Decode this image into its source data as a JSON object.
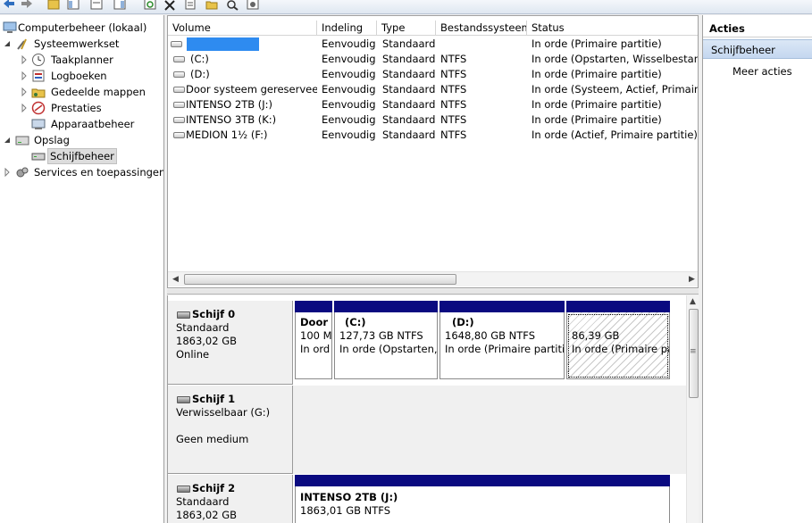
{
  "tree": {
    "items": [
      {
        "label": "Computerbeheer (lokaal)",
        "icon": "computer-icon"
      },
      {
        "label": "Systeemwerkset",
        "icon": "tools-icon"
      },
      {
        "label": "Taakplanner",
        "icon": "clock-icon"
      },
      {
        "label": "Logboeken",
        "icon": "event-log-icon"
      },
      {
        "label": "Gedeelde mappen",
        "icon": "shared-folder-icon"
      },
      {
        "label": "Prestaties",
        "icon": "performance-icon"
      },
      {
        "label": "Apparaatbeheer",
        "icon": "device-manager-icon"
      },
      {
        "label": "Opslag",
        "icon": "storage-icon"
      },
      {
        "label": "Schijfbeheer",
        "icon": "disk-management-icon"
      },
      {
        "label": "Services en toepassingen",
        "icon": "services-icon"
      }
    ]
  },
  "volumes": {
    "columns": [
      "Volume",
      "Indeling",
      "Type",
      "Bestandssysteem",
      "Status"
    ],
    "rows": [
      {
        "volume": "",
        "indeling": "Eenvoudig",
        "type": "Standaard",
        "fs": "",
        "status": "In orde (Primaire partitie)"
      },
      {
        "volume": "(C:)",
        "indeling": "Eenvoudig",
        "type": "Standaard",
        "fs": "NTFS",
        "status": "In orde (Opstarten, Wisselbestand, C"
      },
      {
        "volume": "(D:)",
        "indeling": "Eenvoudig",
        "type": "Standaard",
        "fs": "NTFS",
        "status": "In orde (Primaire partitie)"
      },
      {
        "volume": "Door systeem gereserveerd",
        "indeling": "Eenvoudig",
        "type": "Standaard",
        "fs": "NTFS",
        "status": "In orde (Systeem, Actief, Primaire pa"
      },
      {
        "volume": "INTENSO 2TB (J:)",
        "indeling": "Eenvoudig",
        "type": "Standaard",
        "fs": "NTFS",
        "status": "In orde (Primaire partitie)"
      },
      {
        "volume": "INTENSO 3TB  (K:)",
        "indeling": "Eenvoudig",
        "type": "Standaard",
        "fs": "NTFS",
        "status": "In orde (Primaire partitie)"
      },
      {
        "volume": "MEDION 1½ (F:)",
        "indeling": "Eenvoudig",
        "type": "Standaard",
        "fs": "NTFS",
        "status": "In orde (Actief, Primaire partitie)"
      }
    ]
  },
  "disks": [
    {
      "name": "Schijf 0",
      "line1": "Standaard",
      "line2": "1863,02 GB",
      "line3": "Online",
      "partitions": [
        {
          "name": "Door",
          "size": "100 M",
          "status": "In ord"
        },
        {
          "name": "(C:)",
          "size": "127,73 GB NTFS",
          "status": "In orde (Opstarten,"
        },
        {
          "name": "(D:)",
          "size": "1648,80 GB NTFS",
          "status": "In orde (Primaire partitie"
        },
        {
          "name": "",
          "size": "86,39 GB",
          "status": "In orde (Primaire pa"
        }
      ]
    },
    {
      "name": "Schijf 1",
      "line1": "Verwisselbaar (G:)",
      "line2": "",
      "line3": "Geen medium"
    },
    {
      "name": "Schijf 2",
      "line1": "Standaard",
      "line2": "1863,02 GB",
      "partitions": [
        {
          "name": "INTENSO 2TB  (J:)",
          "size": "1863,01 GB NTFS"
        }
      ]
    }
  ],
  "actions": {
    "title": "Acties",
    "section": "Schijfbeheer",
    "item": "Meer acties"
  },
  "colors": {
    "partition_bar": "#0a0a80",
    "redaction": "#2e8bf0",
    "section_bg": "#c4d7ef"
  }
}
